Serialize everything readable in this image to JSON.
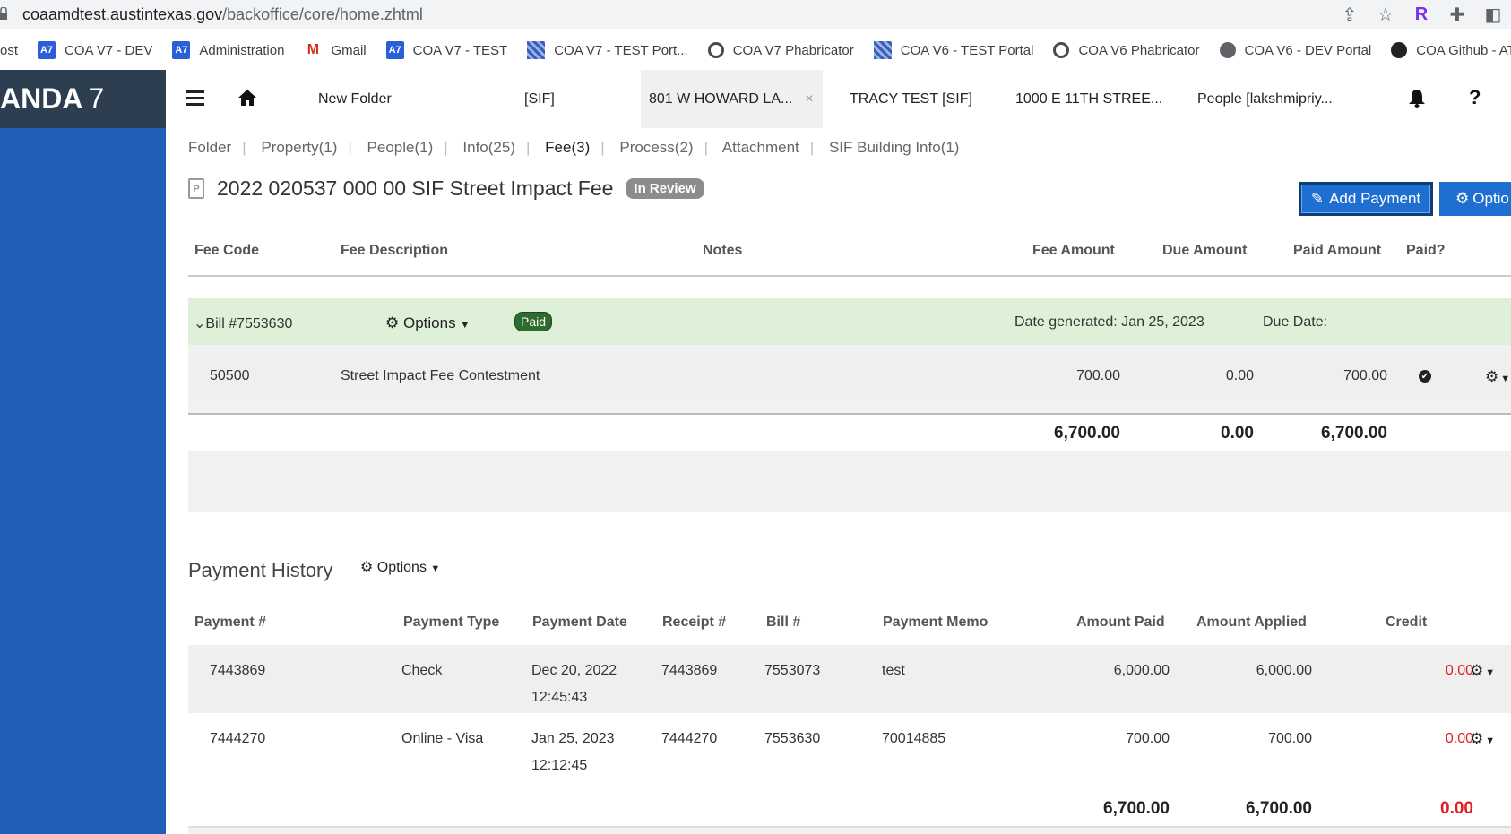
{
  "browser": {
    "url_host": "coaamdtest.austintexas.gov",
    "url_path": "/backoffice/core/home.zhtml",
    "extension_r": "R"
  },
  "bookmarks": [
    {
      "label": "ost",
      "icon": "none"
    },
    {
      "label": "COA V7 - DEV",
      "icon": "a7"
    },
    {
      "label": "Administration",
      "icon": "a7"
    },
    {
      "label": "Gmail",
      "icon": "gmail"
    },
    {
      "label": "COA V7 - TEST",
      "icon": "a7"
    },
    {
      "label": "COA V7 - TEST Port...",
      "icon": "grid"
    },
    {
      "label": "COA V7 Phabricator",
      "icon": "gear"
    },
    {
      "label": "COA V6 - TEST Portal",
      "icon": "grid"
    },
    {
      "label": "COA V6 Phabricator",
      "icon": "gear"
    },
    {
      "label": "COA V6 - DEV Portal",
      "icon": "globe"
    },
    {
      "label": "COA Github - ATD",
      "icon": "github"
    }
  ],
  "brand": {
    "name": "ANDA",
    "version": "7"
  },
  "folder_tabs": [
    {
      "label": "New Folder"
    },
    {
      "label": "[SIF]"
    },
    {
      "label": "801 W HOWARD LA...",
      "active": true,
      "close": "×"
    },
    {
      "label": "TRACY TEST [SIF]"
    },
    {
      "label": "1000 E 11TH STREE..."
    },
    {
      "label": "People [lakshmipriy..."
    }
  ],
  "help_label": "?",
  "subnav": [
    {
      "label": "Folder"
    },
    {
      "label": "Property(1)"
    },
    {
      "label": "People(1)"
    },
    {
      "label": "Info(25)"
    },
    {
      "label": "Fee(3)",
      "active": true
    },
    {
      "label": "Process(2)"
    },
    {
      "label": "Attachment"
    },
    {
      "label": "SIF Building Info(1)"
    }
  ],
  "fee": {
    "doc_letter": "P",
    "title": "2022 020537 000 00 SIF Street Impact Fee",
    "status": "In Review",
    "add_payment_label": "Add Payment",
    "options_label": "Optio"
  },
  "fee_table": {
    "headers": {
      "fee_code": "Fee Code",
      "fee_description": "Fee Description",
      "notes": "Notes",
      "fee_amount": "Fee Amount",
      "due_amount": "Due Amount",
      "paid_amount": "Paid Amount",
      "paid": "Paid?"
    },
    "bill": {
      "label": "Bill #7553630",
      "options_label": "Options",
      "status": "Paid",
      "date_generated": "Date generated: Jan 25, 2023",
      "due_date": "Due Date:"
    },
    "line": {
      "code": "50500",
      "description": "Street Impact Fee Contestment",
      "fee_amount": "700.00",
      "due_amount": "0.00",
      "paid_amount": "700.00"
    },
    "totals": {
      "fee_amount": "6,700.00",
      "due_amount": "0.00",
      "paid_amount": "6,700.00"
    }
  },
  "payment_history": {
    "title": "Payment History",
    "options_label": "Options",
    "headers": {
      "payment_no": "Payment #",
      "payment_type": "Payment Type",
      "payment_date": "Payment Date",
      "receipt_no": "Receipt #",
      "bill_no": "Bill #",
      "memo": "Payment Memo",
      "amount_paid": "Amount Paid",
      "amount_applied": "Amount Applied",
      "credit": "Credit"
    },
    "rows": [
      {
        "payment_no": "7443869",
        "type": "Check",
        "date": "Dec 20, 2022",
        "time": "12:45:43",
        "receipt": "7443869",
        "bill": "7553073",
        "memo": "test",
        "amount_paid": "6,000.00",
        "amount_applied": "6,000.00",
        "credit": "0.00"
      },
      {
        "payment_no": "7444270",
        "type": "Online - Visa",
        "date": "Jan 25, 2023",
        "time": "12:12:45",
        "receipt": "7444270",
        "bill": "7553630",
        "memo": "70014885",
        "amount_paid": "700.00",
        "amount_applied": "700.00",
        "credit": "0.00"
      }
    ],
    "totals": {
      "amount_paid": "6,700.00",
      "amount_applied": "6,700.00",
      "credit": "0.00"
    }
  },
  "colors": {
    "sidebar": "#1f5fb8",
    "brand_bg": "#2c3e50",
    "primary_button": "#1f6fd1",
    "bill_row": "#dff0d8",
    "credit": "#e02020"
  }
}
